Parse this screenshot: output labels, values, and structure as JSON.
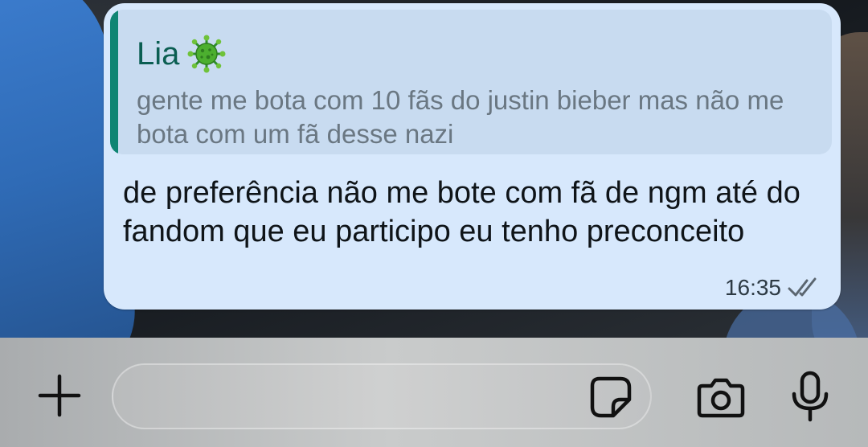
{
  "quoted_message": {
    "author": "Lia",
    "author_emoji": "virus-emoji",
    "text": "gente me bota com 10 fãs do justin bieber mas não me bota com um fã desse nazi"
  },
  "message": {
    "text": "de preferência não me bote com fã de ngm até do fandom que eu participo eu tenho preconceito",
    "time": "16:35",
    "status_icon": "double-check-icon"
  },
  "composer": {
    "placeholder": "",
    "icons": [
      "plus-icon",
      "sticker-icon",
      "camera-icon",
      "microphone-icon"
    ]
  },
  "colors": {
    "bubble": "#d7e8fc",
    "quote_bar": "#0f8573",
    "author": "#0b5e52"
  }
}
